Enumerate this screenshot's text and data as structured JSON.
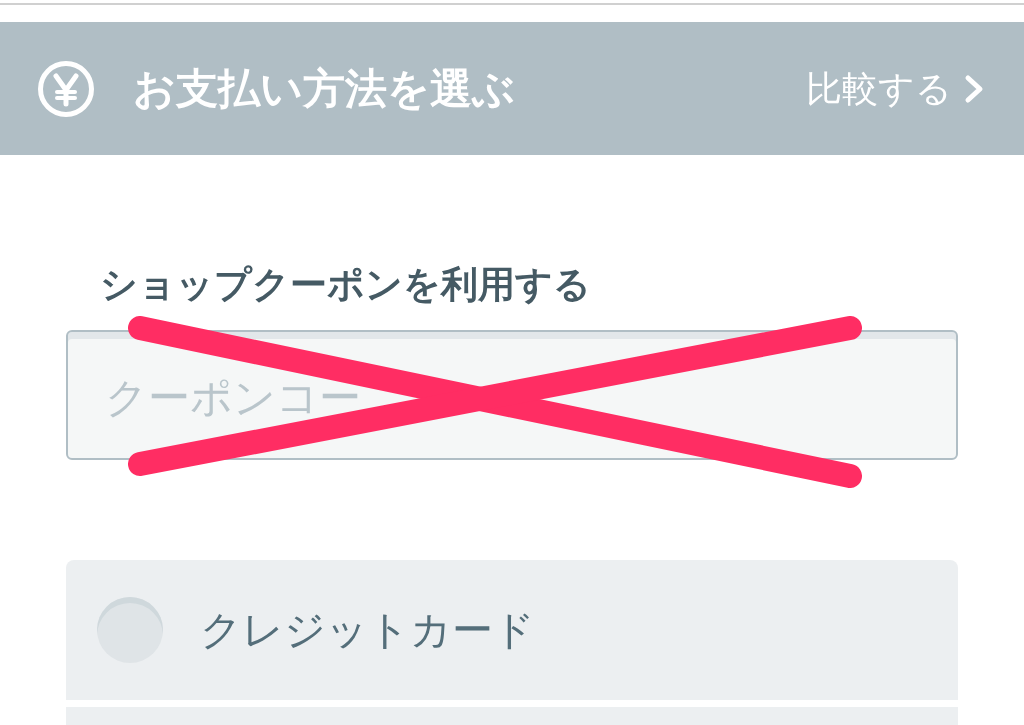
{
  "header": {
    "title": "お支払い方法を選ぶ",
    "compare_link": "比較する"
  },
  "coupon": {
    "label": "ショップクーポンを利用する",
    "placeholder": "クーポンコー",
    "crossed_out": true
  },
  "payment_options": [
    {
      "label": "クレジットカード",
      "selected": false
    }
  ]
}
